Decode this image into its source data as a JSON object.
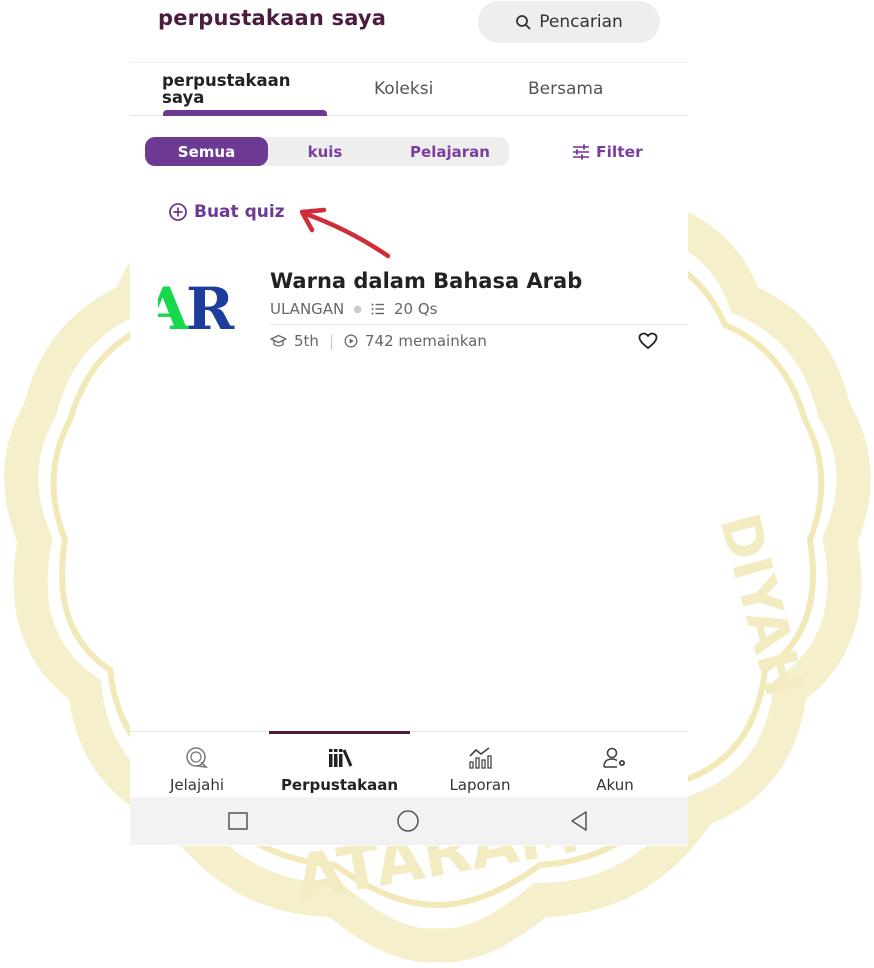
{
  "header": {
    "title": "perpustakaan saya",
    "search_label": "Pencarian"
  },
  "tabs": [
    {
      "label": "perpustakaan saya",
      "active": true
    },
    {
      "label": "Koleksi",
      "active": false
    },
    {
      "label": "Bersama",
      "active": false
    }
  ],
  "filters": {
    "chips": [
      {
        "label": "Semua",
        "active": true
      },
      {
        "label": "kuis",
        "active": false
      },
      {
        "label": "Pelajaran",
        "active": false
      }
    ],
    "filter_label": "Filter"
  },
  "create": {
    "label": "Buat quiz"
  },
  "quiz": {
    "thumbnail_text": "AR",
    "title": "Warna dalam Bahasa Arab",
    "type": "ULANGAN",
    "questions": "20 Qs",
    "grade": "5th",
    "plays": "742 memainkan"
  },
  "bottom_nav": [
    {
      "label": "Jelajahi",
      "icon": "explore-icon",
      "active": false
    },
    {
      "label": "Perpustakaan",
      "icon": "library-icon",
      "active": true
    },
    {
      "label": "Laporan",
      "icon": "report-icon",
      "active": false
    },
    {
      "label": "Akun",
      "icon": "account-icon",
      "active": false
    }
  ],
  "colors": {
    "primary": "#6d3a93",
    "title": "#4a1d3f",
    "annotation_arrow": "#d12c3a",
    "watermark": "#f2e6a6"
  }
}
